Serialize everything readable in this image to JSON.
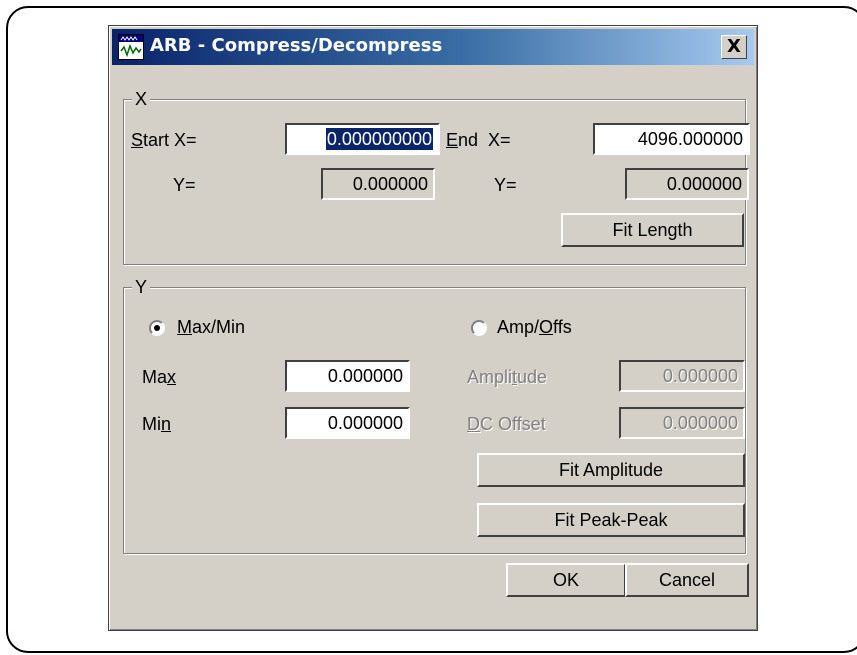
{
  "dialog": {
    "title": "ARB - Compress/Decompress",
    "close_label": "X"
  },
  "x_group": {
    "legend": "X",
    "start_x": {
      "label_prefix": "",
      "label_mnemonic": "S",
      "label_rest": "tart X=",
      "value": "0.000000000"
    },
    "end_x": {
      "label_mnemonic": "E",
      "label_rest": "nd  X=",
      "value": "4096.000000"
    },
    "start_y": {
      "label": "Y=",
      "value": "0.000000"
    },
    "end_y": {
      "label": "Y=",
      "value": "0.000000"
    },
    "fit_length_label": "Fit Length"
  },
  "y_group": {
    "legend": "Y",
    "maxmin_radio": {
      "mnemonic": "M",
      "rest": "ax/Min",
      "selected": true
    },
    "ampoffs_radio": {
      "prefix": "Amp/",
      "mnemonic": "O",
      "rest": "ffs",
      "selected": false
    },
    "max": {
      "prefix": "Ma",
      "mnemonic": "x",
      "value": "0.000000"
    },
    "min": {
      "prefix": "Mi",
      "mnemonic": "n",
      "value": "0.000000"
    },
    "amplitude": {
      "prefix": "Ampli",
      "mnemonic": "t",
      "rest": "ude",
      "value": "0.000000"
    },
    "dc_offset": {
      "mnemonic": "D",
      "rest": "C Offset",
      "value": "0.000000"
    },
    "fit_amplitude_label": "Fit Amplitude",
    "fit_peak_peak_label": "Fit Peak-Peak"
  },
  "footer": {
    "ok_label": "OK",
    "cancel_label": "Cancel"
  }
}
